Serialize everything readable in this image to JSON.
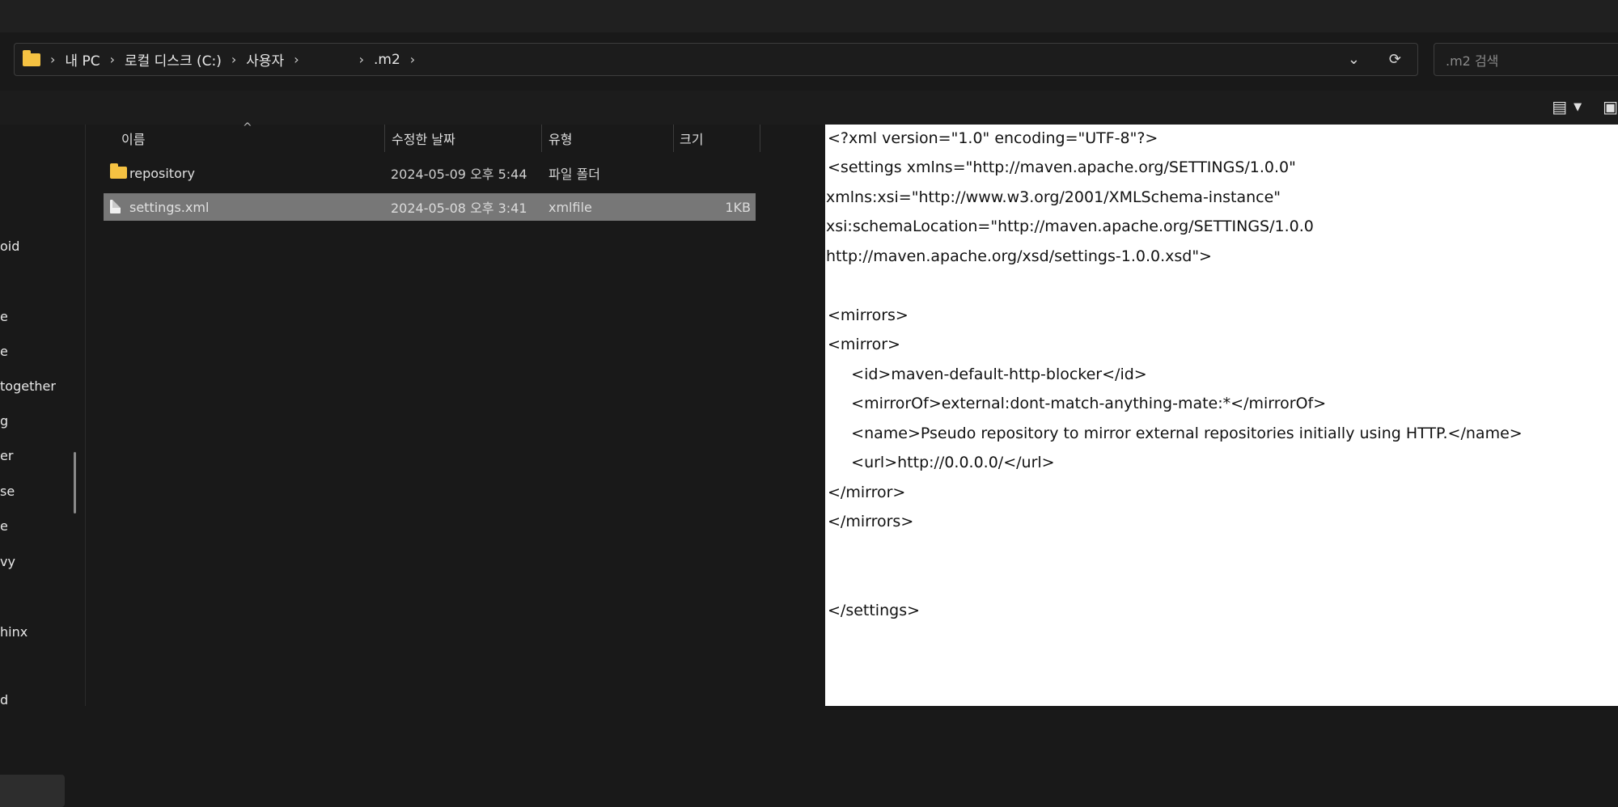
{
  "breadcrumb": {
    "items": [
      "내 PC",
      "로컬 디스크 (C:)",
      "사용자",
      "",
      ".m2"
    ]
  },
  "search": {
    "placeholder": ".m2 검색"
  },
  "nav": {
    "items": [
      "oid",
      "e",
      "e",
      "together",
      "g",
      "er",
      "se",
      "e",
      "vy",
      "hinx",
      "d"
    ]
  },
  "columns": {
    "name": "이름",
    "modified": "수정한 날짜",
    "type": "유형",
    "size": "크기"
  },
  "files": [
    {
      "name": "repository",
      "modified": "2024-05-09 오후 5:44",
      "type": "파일 폴더",
      "size": "",
      "icon": "folder-icon"
    },
    {
      "name": "settings.xml",
      "modified": "2024-05-08 오후 3:41",
      "type": "xmlfile",
      "size": "1KB",
      "icon": "file-icon",
      "selected": true
    }
  ],
  "preview": {
    "lines": [
      "<?xml version=\"1.0\" encoding=\"UTF-8\"?>",
      "<settings xmlns=\"http://maven.apache.org/SETTINGS/1.0.0\"",
      "xmlns:xsi=\"http://www.w3.org/2001/XMLSchema-instance\"",
      "xsi:schemaLocation=\"http://maven.apache.org/SETTINGS/1.0.0",
      "http://maven.apache.org/xsd/settings-1.0.0.xsd\">",
      "",
      "<mirrors>",
      "<mirror>",
      "    <id>maven-default-http-blocker</id>",
      "    <mirrorOf>external:dont-match-anything-mate:*</mirrorOf>",
      "    <name>Pseudo repository to mirror external repositories initially using HTTP.</name>",
      "    <url>http://0.0.0.0/</url>",
      "</mirror>",
      "</mirrors>",
      "",
      "",
      "",
      "</settings>"
    ]
  },
  "colors": {
    "accent_folder": "#f5c242",
    "selected_row": "#777777",
    "preview_bg": "#ffffff"
  }
}
